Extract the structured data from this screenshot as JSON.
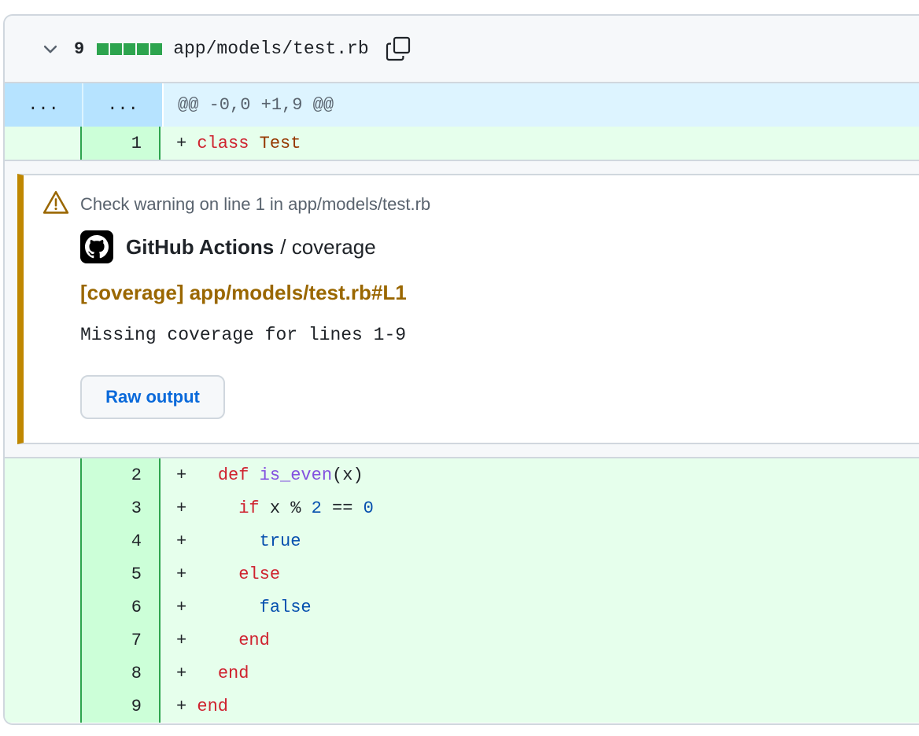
{
  "file": {
    "changes": "9",
    "path": "app/models/test.rb",
    "diffstat_blocks": 5,
    "added_color": "#2da44e"
  },
  "hunk": {
    "old_ellipsis": "...",
    "new_ellipsis": "...",
    "header": "@@ -0,0 +1,9 @@"
  },
  "lines": [
    {
      "num": "1",
      "tokens": [
        {
          "t": "+ ",
          "c": ""
        },
        {
          "t": "class",
          "c": "k"
        },
        {
          "t": " ",
          "c": ""
        },
        {
          "t": "Test",
          "c": "c"
        }
      ]
    },
    {
      "num": "2",
      "tokens": [
        {
          "t": "+   ",
          "c": ""
        },
        {
          "t": "def",
          "c": "k"
        },
        {
          "t": " ",
          "c": ""
        },
        {
          "t": "is_even",
          "c": "f"
        },
        {
          "t": "(x)",
          "c": ""
        }
      ]
    },
    {
      "num": "3",
      "tokens": [
        {
          "t": "+     ",
          "c": ""
        },
        {
          "t": "if",
          "c": "k"
        },
        {
          "t": " x % ",
          "c": ""
        },
        {
          "t": "2",
          "c": "b"
        },
        {
          "t": " == ",
          "c": ""
        },
        {
          "t": "0",
          "c": "b"
        }
      ]
    },
    {
      "num": "4",
      "tokens": [
        {
          "t": "+       ",
          "c": ""
        },
        {
          "t": "true",
          "c": "b"
        }
      ]
    },
    {
      "num": "5",
      "tokens": [
        {
          "t": "+     ",
          "c": ""
        },
        {
          "t": "else",
          "c": "k"
        }
      ]
    },
    {
      "num": "6",
      "tokens": [
        {
          "t": "+       ",
          "c": ""
        },
        {
          "t": "false",
          "c": "b"
        }
      ]
    },
    {
      "num": "7",
      "tokens": [
        {
          "t": "+     ",
          "c": ""
        },
        {
          "t": "end",
          "c": "k"
        }
      ]
    },
    {
      "num": "8",
      "tokens": [
        {
          "t": "+   ",
          "c": ""
        },
        {
          "t": "end",
          "c": "k"
        }
      ]
    },
    {
      "num": "9",
      "tokens": [
        {
          "t": "+ ",
          "c": ""
        },
        {
          "t": "end",
          "c": "k"
        }
      ]
    }
  ],
  "annotation": {
    "warning": "Check warning on line 1 in app/models/test.rb",
    "app_name": "GitHub Actions",
    "separator": "/ coverage",
    "title": "[coverage] app/models/test.rb#L1",
    "message": "Missing coverage for lines 1-9",
    "raw_button": "Raw output",
    "accent_color": "#bf8700"
  }
}
